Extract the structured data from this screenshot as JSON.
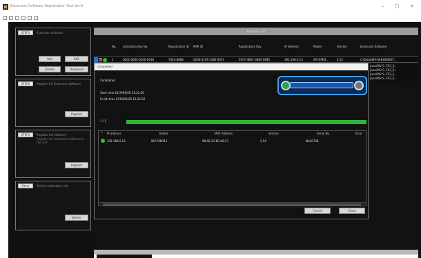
{
  "window": {
    "title": "Extension Software Registration Tool Ver.6",
    "minimize": "–",
    "maximize": "□",
    "close": "✕"
  },
  "toolbar": {
    "icons": [
      "back-icon",
      "forward-icon",
      "refresh-icon",
      "export-icon",
      "info-icon",
      "settings-icon"
    ]
  },
  "sidebar": {
    "group1": {
      "tag": "STEP1",
      "caption": "Extension software",
      "buttons": {
        "add": "Add",
        "edit": "Edit",
        "delete": "Delete",
        "download": "Download"
      }
    },
    "group2": {
      "tag": "STEP2",
      "caption": "Register the Extension Software",
      "button": "Register"
    },
    "group3": {
      "tag": "STEP3",
      "caption": "Register the software",
      "desc": "Register the extension software to the unit.",
      "button": "Register"
    },
    "group4": {
      "tag": "Other",
      "caption": "Delete registration info",
      "button": "Delete"
    }
  },
  "main": {
    "header": "Extension list",
    "columns": {
      "no": "No.",
      "activation": "Activation Key No.",
      "regid": "Registration ID",
      "mprid": "MPR ID",
      "regkey": "Registration Key",
      "ip": "IP Address",
      "model": "Model",
      "version": "Version",
      "ext": "Extension Software"
    },
    "row": {
      "no": "1",
      "activation": "0001-0000-0100-0018",
      "regid": "7424-8888",
      "mprid": "0200-0109-2382-94F3",
      "regkey": "0107-4801-3885-0885",
      "ip": "192.168.0.13",
      "model": "WV-SPN3...",
      "version": "2.54",
      "ext": "C:\\Data\\WV-SAE300/EXT..."
    },
    "strip": [
      "p\\ua\\WV-S..FR3_S.. ",
      "p\\ua\\WV-S..FR3_S.. ",
      "p\\ua\\WV-S..FR3_S.. ",
      "p\\ua\\WV-S..FR3_S.. "
    ]
  },
  "dialog": {
    "title": "Completed",
    "status": "Completed.",
    "start_label": "Start time",
    "start_time": "2019/09/26 12:22:30",
    "finish_label": "Finish time",
    "finish_time": "2019/09/26 12:22:32",
    "counter": "1 / 1",
    "progress": 1.0,
    "list_columns": {
      "ip": "IP address",
      "model": "Model",
      "mac": "MAC Address",
      "version": "Version",
      "serial": "Serial No.",
      "error": "Error"
    },
    "list_row": {
      "ip": "192.168.0.13",
      "model": "WV-SPN311",
      "mac": "08-00-23-6D-48-F3",
      "version": "2.54",
      "serial": "NA20738"
    },
    "cancel": "Cancel",
    "close": "Close"
  }
}
